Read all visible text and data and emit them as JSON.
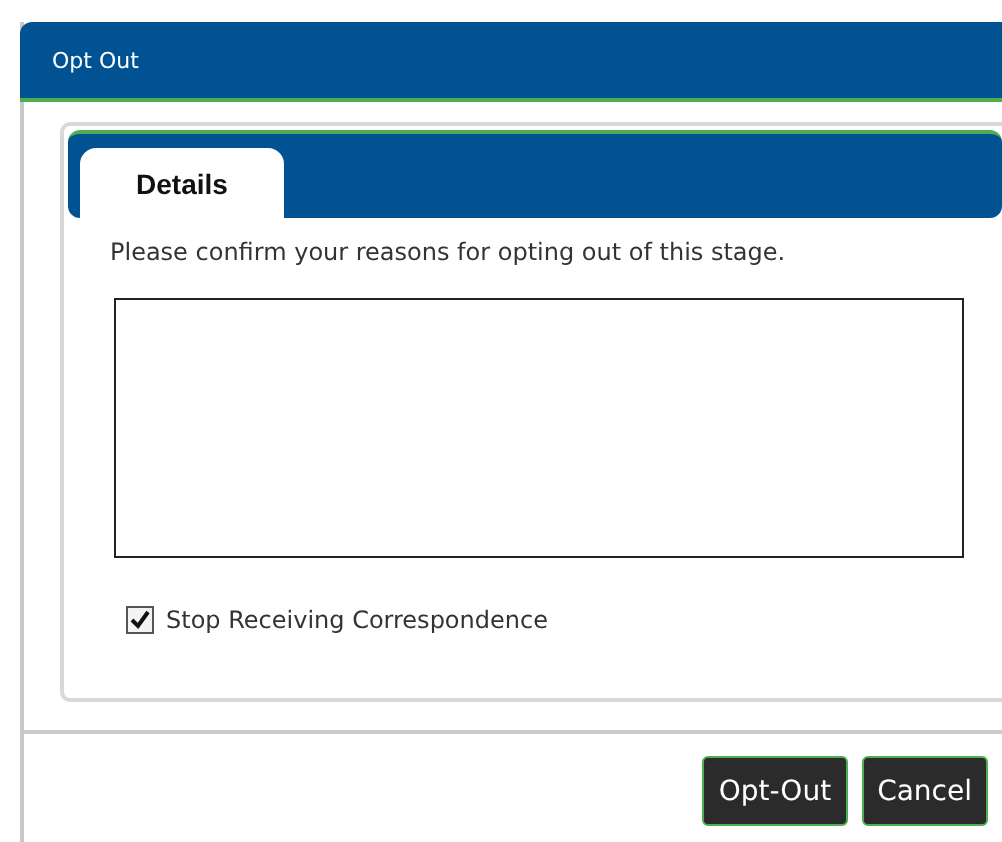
{
  "window": {
    "title": "Opt Out"
  },
  "tabs": [
    {
      "label": "Details",
      "selected": true
    }
  ],
  "prompt": "Please confirm your reasons for opting out of this stage.",
  "stop_correspondence": {
    "label": "Stop Receiving Correspondence",
    "checked": true
  },
  "buttons": [
    "Opt-Out",
    "Cancel"
  ]
}
